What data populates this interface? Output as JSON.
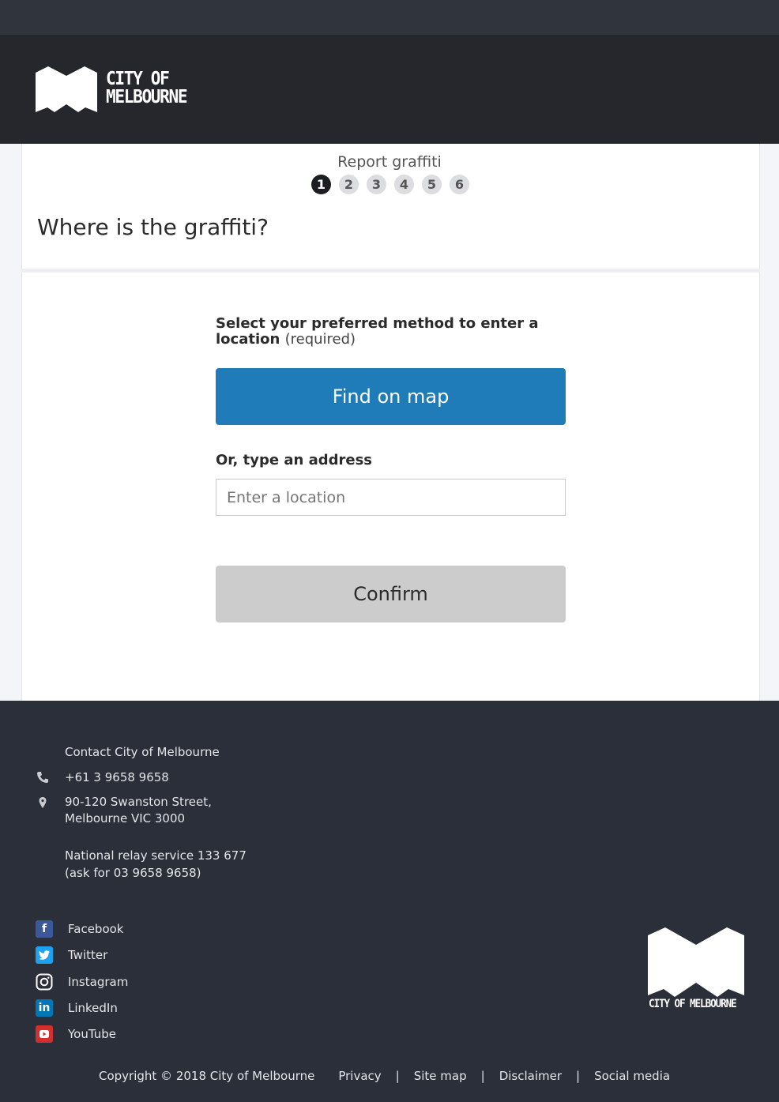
{
  "brand": {
    "name_line1": "CITY OF",
    "name_line2": "MELBOURNE",
    "footer_name": "CITY OF MELBOURNE"
  },
  "progress": {
    "title": "Report graffiti",
    "steps": [
      "1",
      "2",
      "3",
      "4",
      "5",
      "6"
    ],
    "current_step": 1
  },
  "page": {
    "heading": "Where is the graffiti?"
  },
  "form": {
    "method_label": "Select your preferred method to enter a location",
    "method_required": "(required)",
    "find_on_map_label": "Find on map",
    "address_label": "Or, type an address",
    "address_placeholder": "Enter a location",
    "address_value": "",
    "confirm_label": "Confirm"
  },
  "footer": {
    "contact_title": "Contact City of Melbourne",
    "phone": "+61 3 9658 9658",
    "address_line1": "90-120 Swanston Street,",
    "address_line2": "Melbourne VIC 3000",
    "relay_line1": "National relay service 133 677",
    "relay_line2": "(ask for 03 9658 9658)",
    "social": [
      {
        "label": "Facebook",
        "icon": "facebook-icon",
        "color": "#3b5998"
      },
      {
        "label": "Twitter",
        "icon": "twitter-icon",
        "color": "#1da1f2"
      },
      {
        "label": "Instagram",
        "icon": "instagram-icon",
        "color": "#2b2f3a"
      },
      {
        "label": "LinkedIn",
        "icon": "linkedin-icon",
        "color": "#0077b5"
      },
      {
        "label": "YouTube",
        "icon": "youtube-icon",
        "color": "#d32f2f"
      }
    ],
    "copyright": "Copyright © 2018 City of Melbourne",
    "links": [
      "Privacy",
      "Site map",
      "Disclaimer",
      "Social media"
    ]
  },
  "colors": {
    "primary_button": "#1f7cb8",
    "header_bg": "#25272d",
    "footer_bg": "#2b2f3a",
    "disabled_button": "#cccccc"
  }
}
